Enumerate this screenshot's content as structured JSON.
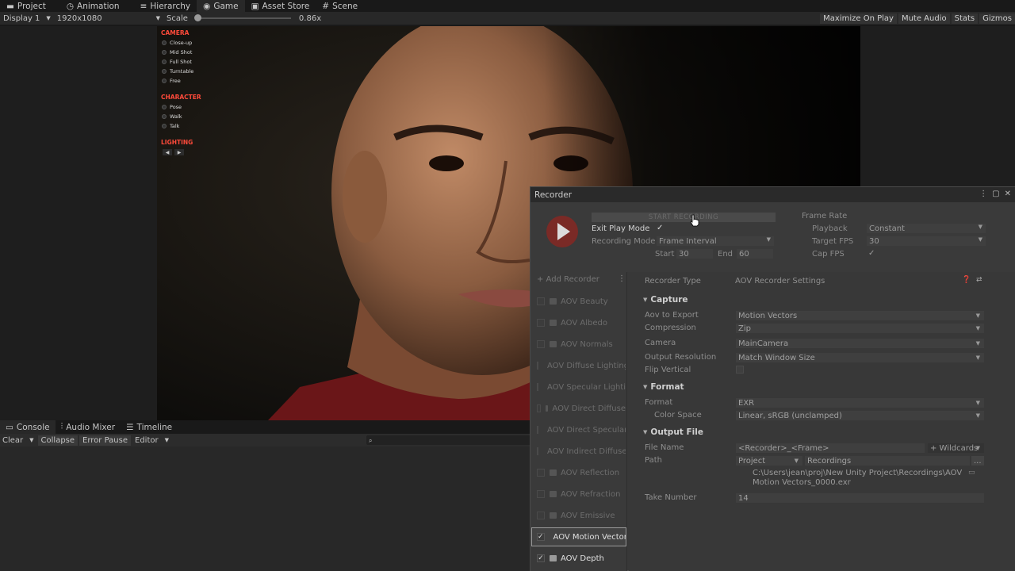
{
  "tabs": [
    {
      "label": "Project",
      "icon": "folder-icon"
    },
    {
      "label": "Animation",
      "icon": "clock-icon"
    },
    {
      "label": "Hierarchy",
      "icon": "list-icon"
    },
    {
      "label": "Game",
      "icon": "gamepad-icon"
    },
    {
      "label": "Asset Store",
      "icon": "bag-icon"
    },
    {
      "label": "Scene",
      "icon": "hash-icon"
    }
  ],
  "game_toolbar": {
    "display": "Display 1",
    "resolution": "1920x1080",
    "scale_label": "Scale",
    "scale_value": "0.86x",
    "scale_fraction": 0.0,
    "maximize": "Maximize On Play",
    "mute": "Mute Audio",
    "stats": "Stats",
    "gizmos": "Gizmos"
  },
  "overlay": {
    "camera_title": "CAMERA",
    "camera_items": [
      "Close-up",
      "Mid Shot",
      "Full Shot",
      "Turntable",
      "Free"
    ],
    "character_title": "CHARACTER",
    "character_items": [
      "Pose",
      "Walk",
      "Talk"
    ],
    "lighting_title": "LIGHTING",
    "lighting_prev": "◀",
    "lighting_next": "▶"
  },
  "bottom_tabs": [
    {
      "label": "Console",
      "icon": "console-icon"
    },
    {
      "label": "Audio Mixer",
      "icon": "mixer-icon"
    },
    {
      "label": "Timeline",
      "icon": "timeline-icon"
    }
  ],
  "console_toolbar": {
    "clear": "Clear",
    "collapse": "Collapse",
    "error_pause": "Error Pause",
    "editor": "Editor"
  },
  "recorder": {
    "title": "Recorder",
    "start_recording": "START RECORDING",
    "exit_play_mode_label": "Exit Play Mode",
    "exit_play_mode_checked": true,
    "recording_mode_label": "Recording Mode",
    "recording_mode_value": "Frame Interval",
    "start_label": "Start",
    "start_value": "30",
    "end_label": "End",
    "end_value": "60",
    "frame_rate_label": "Frame Rate",
    "playback_label": "Playback",
    "playback_value": "Constant",
    "target_fps_label": "Target FPS",
    "target_fps_value": "30",
    "cap_fps_label": "Cap FPS",
    "cap_fps_checked": true,
    "add_recorder": "+ Add Recorder",
    "recorders": [
      {
        "label": "AOV Beauty",
        "checked": false
      },
      {
        "label": "AOV Albedo",
        "checked": false
      },
      {
        "label": "AOV Normals",
        "checked": false
      },
      {
        "label": "AOV Diffuse Lighting",
        "checked": false
      },
      {
        "label": "AOV Specular Lighting",
        "checked": false
      },
      {
        "label": "AOV Direct Diffuse",
        "checked": false
      },
      {
        "label": "AOV Direct Specular",
        "checked": false
      },
      {
        "label": "AOV Indirect Diffuse",
        "checked": false
      },
      {
        "label": "AOV Reflection",
        "checked": false
      },
      {
        "label": "AOV Refraction",
        "checked": false
      },
      {
        "label": "AOV Emissive",
        "checked": false
      },
      {
        "label": "AOV Motion Vectors",
        "checked": true,
        "selected": true
      },
      {
        "label": "AOV Depth",
        "checked": true
      }
    ],
    "recorder_type_label": "Recorder Type",
    "recorder_type_value": "AOV Recorder Settings",
    "capture_section": "Capture",
    "aov_label": "Aov to Export",
    "aov_value": "Motion Vectors",
    "compression_label": "Compression",
    "compression_value": "Zip",
    "camera_label": "Camera",
    "camera_value": "MainCamera",
    "output_res_label": "Output Resolution",
    "output_res_value": "Match Window Size",
    "flip_vertical_label": "Flip Vertical",
    "format_section": "Format",
    "format_label": "Format",
    "format_value": "EXR",
    "color_space_label": "Color Space",
    "color_space_value": "Linear, sRGB (unclamped)",
    "output_file_section": "Output File",
    "file_name_label": "File Name",
    "file_name_value": "<Recorder>_<Frame>",
    "wildcards": "+ Wildcards",
    "path_label": "Path",
    "path_root": "Project",
    "path_folder": "Recordings",
    "path_browse": "...",
    "full_path_line1": "C:\\Users\\jean\\proj\\New Unity Project\\Recordings\\AOV",
    "full_path_line2": "Motion Vectors_0000.exr",
    "take_number_label": "Take Number",
    "take_number_value": "14"
  },
  "colors": {
    "accent_red": "#ff4a3a",
    "record_button": "#7a2a26",
    "panel_bg": "#383838"
  }
}
